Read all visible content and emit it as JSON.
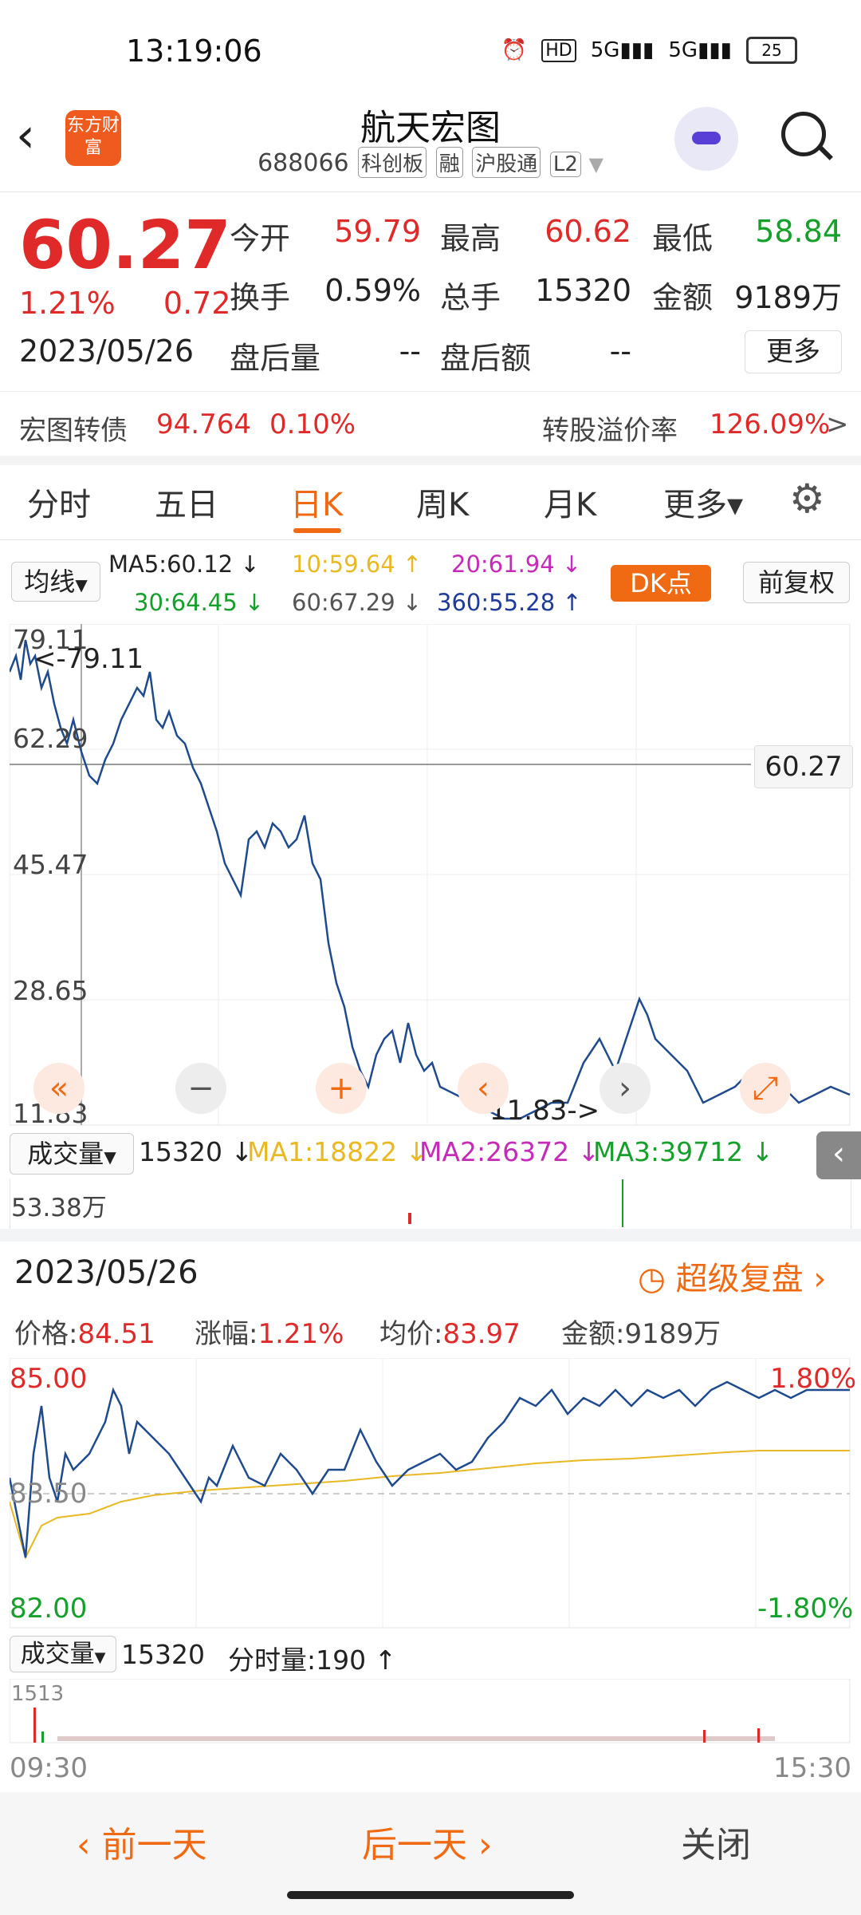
{
  "status": {
    "time": "13:19:06",
    "battery": "25"
  },
  "header": {
    "title": "航天宏图",
    "code": "688066",
    "tags": [
      "科创板",
      "融",
      "沪股通",
      "L2"
    ],
    "logo_text": "东方财富"
  },
  "quote": {
    "price": "60.27",
    "change_pct": "1.21%",
    "change": "0.72",
    "date": "2023/05/26",
    "open_label": "今开",
    "open": "59.79",
    "high_label": "最高",
    "high": "60.62",
    "low_label": "最低",
    "low": "58.84",
    "turnover_label": "换手",
    "turnover": "0.59%",
    "volume_label": "总手",
    "volume": "15320",
    "amount_label": "金额",
    "amount": "9189万",
    "after_vol_label": "盘后量",
    "after_vol": "--",
    "after_amt_label": "盘后额",
    "after_amt": "--",
    "more_button": "更多"
  },
  "bond": {
    "name": "宏图转债",
    "price": "94.764",
    "pct": "0.10%",
    "premium_label": "转股溢价率",
    "premium": "126.09%",
    "arrow": ">"
  },
  "tabs": [
    "分时",
    "五日",
    "日K",
    "周K",
    "月K",
    "更多▾"
  ],
  "active_tab": "日K",
  "ma": {
    "selector": "均线",
    "ma5": "MA5:60.12",
    "ma10": "10:59.64",
    "ma20": "20:61.94",
    "ma30": "30:64.45",
    "ma60": "60:67.29",
    "ma360": "360:55.28",
    "dk_button": "DK点",
    "adjust_button": "前复权"
  },
  "kline": {
    "y_labels": [
      "79.11",
      "62.29",
      "45.47",
      "28.65",
      "11.83"
    ],
    "max_marker": "<-79.11",
    "min_marker": "11.83->",
    "current_price": "60.27",
    "colors": {
      "line": "#1f4a8c",
      "grid": "#e6e6e6"
    }
  },
  "volume_bar": {
    "selector": "成交量",
    "value": "15320",
    "ma1": "MA1:18822",
    "ma2": "MA2:26372",
    "ma3": "MA3:39712",
    "axis_max": "53.38万"
  },
  "detail": {
    "date": "2023/05/26",
    "replay_button": "超级复盘",
    "price_label": "价格:",
    "price": "84.51",
    "pct_label": "涨幅:",
    "pct": "1.21%",
    "avg_label": "均价:",
    "avg": "83.97",
    "amount_label": "金额:",
    "amount": "9189万",
    "y_top": "85.00",
    "y_mid": "83.50",
    "y_bottom": "82.00",
    "pct_top": "1.80%",
    "pct_bottom": "-1.80%",
    "vol_selector": "成交量",
    "vol_value": "15320",
    "tick_vol_label": "分时量:190",
    "vol_axis": "1513",
    "time_start": "09:30",
    "time_end": "15:30"
  },
  "footer": {
    "prev": "前一天",
    "next": "后一天",
    "close": "关闭"
  }
}
